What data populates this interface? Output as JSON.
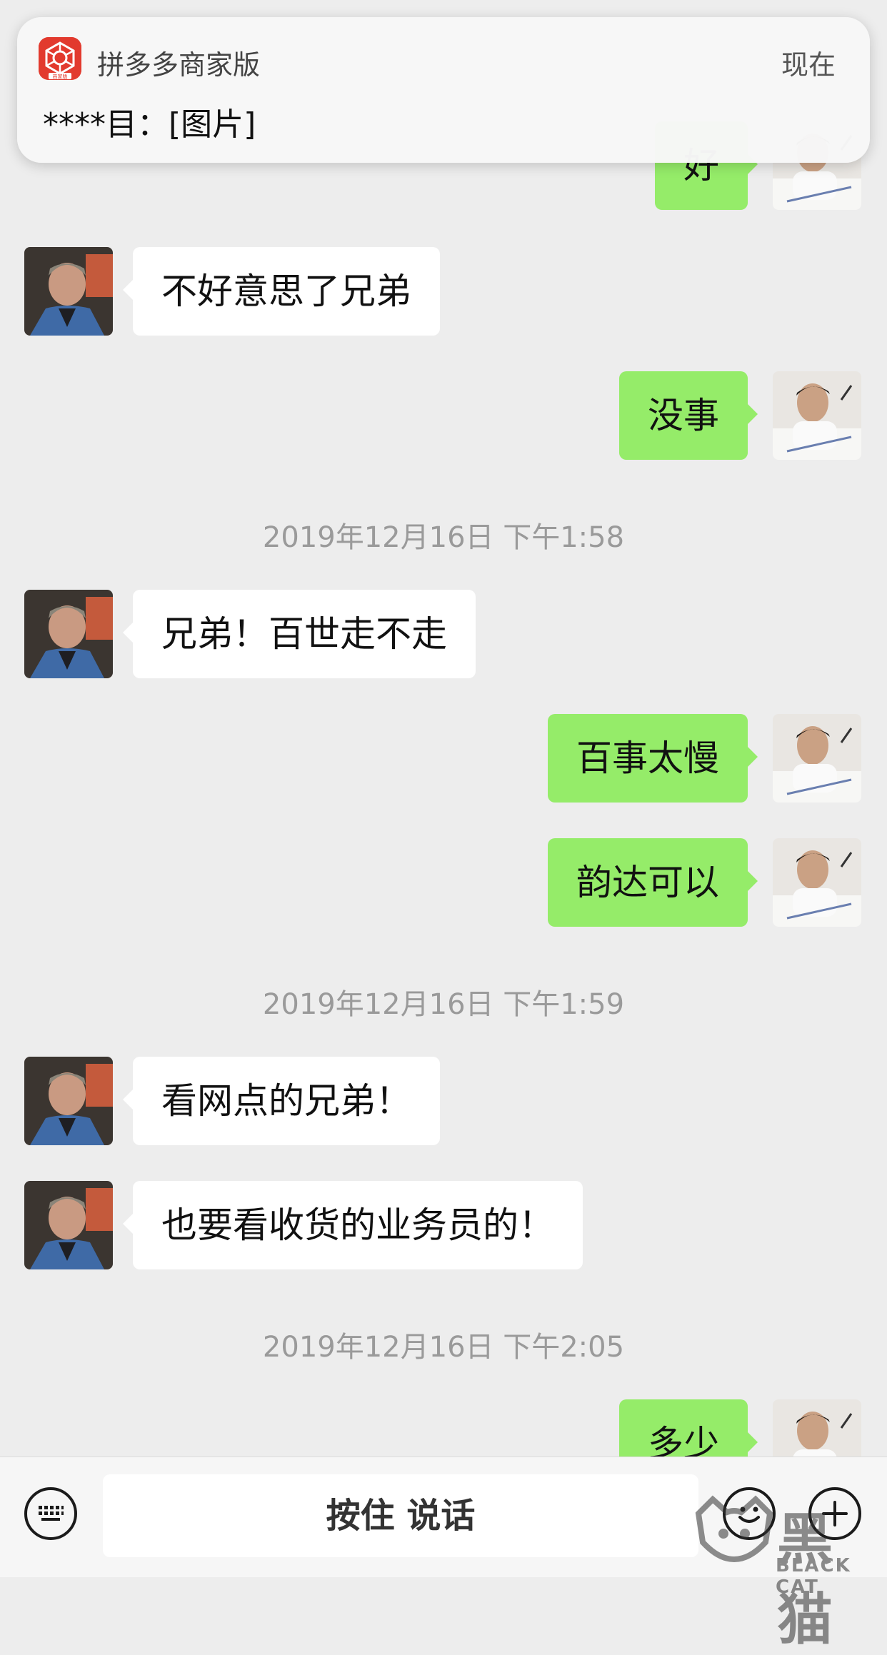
{
  "notification": {
    "app_name": "拼多多商家版",
    "time": "现在",
    "message": "****目：[图片]",
    "icon": "pinduoduo-merchant-icon",
    "icon_badge": "商家版"
  },
  "messages": [
    {
      "side": "right",
      "text": "好"
    },
    {
      "side": "left",
      "text": "不好意思了兄弟"
    },
    {
      "side": "right",
      "text": "没事"
    },
    {
      "type": "timestamp",
      "text": "2019年12月16日 下午1:58"
    },
    {
      "side": "left",
      "text": "兄弟！百世走不走"
    },
    {
      "side": "right",
      "text": "百事太慢"
    },
    {
      "side": "right",
      "text": "韵达可以"
    },
    {
      "type": "timestamp",
      "text": "2019年12月16日 下午1:59"
    },
    {
      "side": "left",
      "text": "看网点的兄弟！"
    },
    {
      "side": "left",
      "text": "也要看收货的业务员的！"
    },
    {
      "type": "timestamp",
      "text": "2019年12月16日 下午2:05"
    },
    {
      "side": "right",
      "text": "多少"
    }
  ],
  "input_bar": {
    "hold_to_talk": "按住 说话",
    "icons": [
      "keyboard-icon",
      "emoji-icon",
      "plus-icon"
    ]
  },
  "watermark": {
    "text": "黑猫",
    "sub": "BLACK CAT"
  },
  "colors": {
    "background": "#ededed",
    "outgoing_bubble": "#95ec69",
    "incoming_bubble": "#ffffff",
    "app_icon": "#e23a2e"
  }
}
